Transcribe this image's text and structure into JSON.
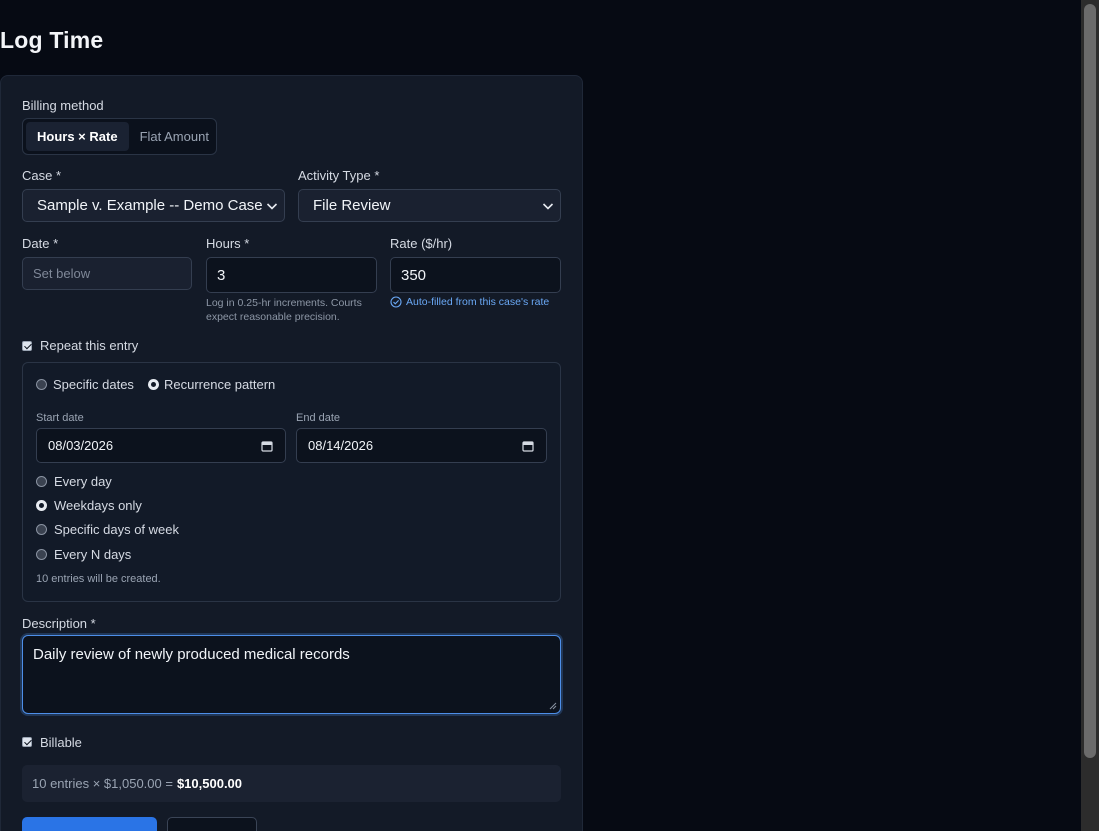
{
  "page": {
    "title": "Log Time"
  },
  "billing": {
    "label": "Billing method",
    "options": [
      "Hours × Rate",
      "Flat Amount"
    ],
    "selected": "Hours × Rate"
  },
  "case": {
    "label": "Case *",
    "value": "Sample v. Example -- Demo Case"
  },
  "activity": {
    "label": "Activity Type *",
    "value": "File Review"
  },
  "date": {
    "label": "Date *",
    "placeholder": "Set below"
  },
  "hours": {
    "label": "Hours *",
    "value": "3",
    "help": "Log in 0.25-hr increments. Courts expect reasonable precision."
  },
  "rate": {
    "label": "Rate ($/hr)",
    "value": "350",
    "autofill": "Auto-filled from this case's rate"
  },
  "repeat": {
    "label": "Repeat this entry",
    "checked": true,
    "modes": [
      "Specific dates",
      "Recurrence pattern"
    ],
    "mode_selected": "Recurrence pattern",
    "start_label": "Start date",
    "start_value": "08/03/2026",
    "end_label": "End date",
    "end_value": "08/14/2026",
    "patterns": [
      "Every day",
      "Weekdays only",
      "Specific days of week",
      "Every N days"
    ],
    "pattern_selected": "Weekdays only",
    "summary": "10 entries will be created."
  },
  "description": {
    "label": "Description *",
    "value": "Daily review of newly produced medical records"
  },
  "billable": {
    "label": "Billable",
    "checked": true
  },
  "total": {
    "prefix": "10 entries × $1,050.00 =",
    "amount": "$10,500.00"
  },
  "colors": {
    "accent": "#2a74e6",
    "focus": "#4d8ee8",
    "background": "#060a13",
    "card": "#131a27"
  }
}
